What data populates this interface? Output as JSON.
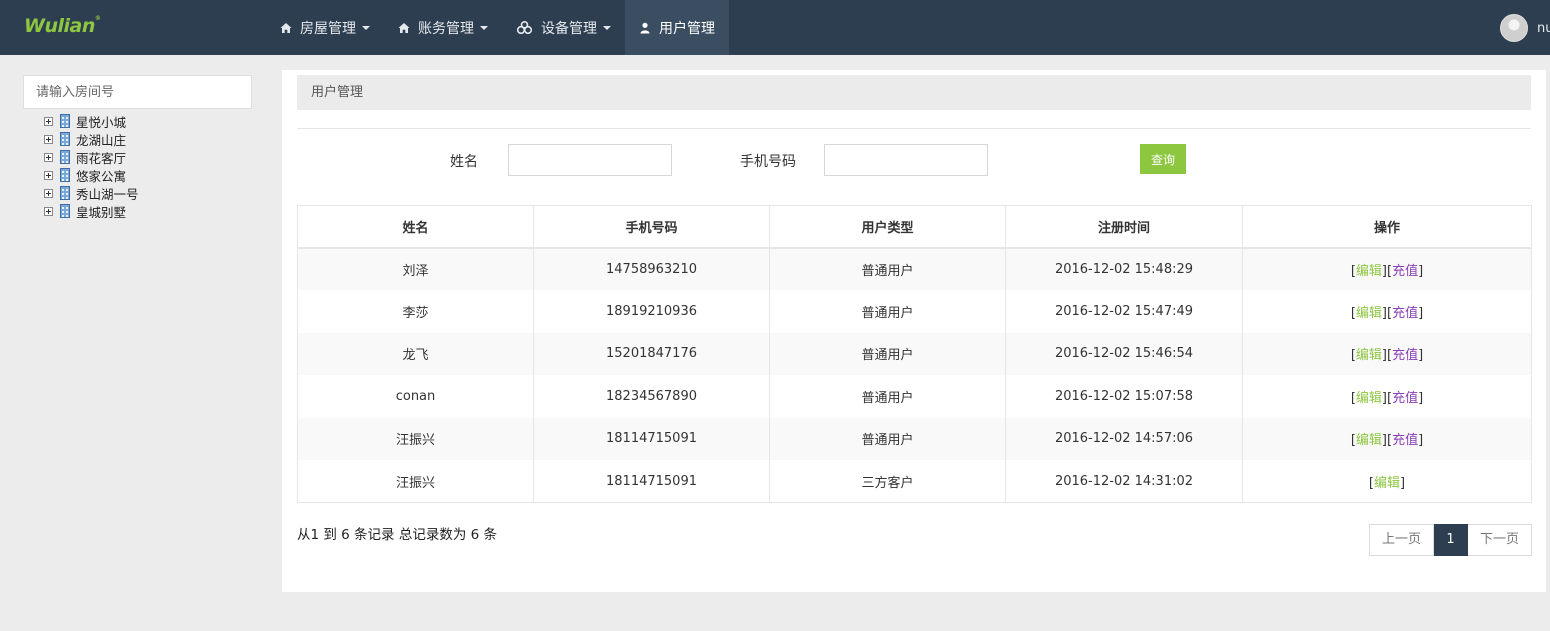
{
  "brand": {
    "logo_text": "Wulian",
    "logo_mark": "®",
    "accent": "#8dc63f",
    "nav_bg": "#2c3e50"
  },
  "nav": {
    "items": [
      {
        "label": "房屋管理",
        "icon": "home-icon",
        "dropdown": true,
        "active": false
      },
      {
        "label": "账务管理",
        "icon": "home-icon",
        "dropdown": true,
        "active": false
      },
      {
        "label": "设备管理",
        "icon": "devices-icon",
        "dropdown": true,
        "active": false
      },
      {
        "label": "用户管理",
        "icon": "user-icon",
        "dropdown": false,
        "active": true
      }
    ],
    "user_name": "nu"
  },
  "sidebar": {
    "search_placeholder": "请输入房间号",
    "tree": [
      {
        "label": "星悦小城",
        "icon": "building-icon"
      },
      {
        "label": "龙湖山庄",
        "icon": "building-icon"
      },
      {
        "label": "雨花客厅",
        "icon": "building-icon"
      },
      {
        "label": "悠家公寓",
        "icon": "building-icon"
      },
      {
        "label": "秀山湖一号",
        "icon": "building-icon"
      },
      {
        "label": "皇城别墅",
        "icon": "building-icon"
      }
    ]
  },
  "main": {
    "breadcrumb": "用户管理",
    "filter": {
      "name_label": "姓名",
      "name_value": "",
      "phone_label": "手机号码",
      "phone_value": "",
      "query_button": "查询"
    },
    "table": {
      "headers": [
        "姓名",
        "手机号码",
        "用户类型",
        "注册时间",
        "操作"
      ],
      "rows": [
        {
          "name": "刘泽",
          "phone": "14758963210",
          "type": "普通用户",
          "time": "2016-12-02 15:48:29",
          "actions": [
            "编辑",
            "充值"
          ]
        },
        {
          "name": "李莎",
          "phone": "18919210936",
          "type": "普通用户",
          "time": "2016-12-02 15:47:49",
          "actions": [
            "编辑",
            "充值"
          ]
        },
        {
          "name": "龙飞",
          "phone": "15201847176",
          "type": "普通用户",
          "time": "2016-12-02 15:46:54",
          "actions": [
            "编辑",
            "充值"
          ]
        },
        {
          "name": "conan",
          "phone": "18234567890",
          "type": "普通用户",
          "time": "2016-12-02 15:07:58",
          "actions": [
            "编辑",
            "充值"
          ]
        },
        {
          "name": "汪振兴",
          "phone": "18114715091",
          "type": "普通用户",
          "time": "2016-12-02 14:57:06",
          "actions": [
            "编辑",
            "充值"
          ]
        },
        {
          "name": "汪振兴",
          "phone": "18114715091",
          "type": "三方客户",
          "time": "2016-12-02 14:31:02",
          "actions": [
            "编辑"
          ]
        }
      ]
    },
    "summary": "从1 到 6 条记录 总记录数为 6 条",
    "pagination": {
      "prev": "上一页",
      "current": "1",
      "next": "下一页"
    }
  }
}
